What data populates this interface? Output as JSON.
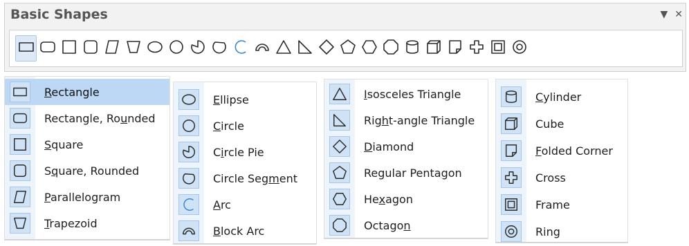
{
  "panel": {
    "title": "Basic Shapes",
    "menu_icon": "▼",
    "close_icon": "✕"
  },
  "toolbar": {
    "icons": [
      "rectangle-icon",
      "rectangle-rounded-icon",
      "square-icon",
      "square-rounded-icon",
      "parallelogram-icon",
      "trapezoid-icon",
      "ellipse-icon",
      "circle-icon",
      "circle-pie-icon",
      "circle-segment-icon",
      "arc-icon",
      "block-arc-icon",
      "isosceles-triangle-icon",
      "right-triangle-icon",
      "diamond-icon",
      "pentagon-icon",
      "hexagon-icon",
      "octagon-icon",
      "cylinder-icon",
      "cube-icon",
      "folded-corner-icon",
      "cross-icon",
      "frame-icon",
      "ring-icon"
    ],
    "active_index": 0
  },
  "columns": [
    {
      "items": [
        {
          "pre": "",
          "u": "R",
          "post": "ectangle",
          "icon": "rectangle-icon"
        },
        {
          "pre": "Rectangle, Ro",
          "u": "u",
          "post": "nded",
          "icon": "rectangle-rounded-icon"
        },
        {
          "pre": "",
          "u": "S",
          "post": "quare",
          "icon": "square-icon"
        },
        {
          "pre": "S",
          "u": "q",
          "post": "uare, Rounded",
          "icon": "square-rounded-icon"
        },
        {
          "pre": "",
          "u": "P",
          "post": "arallelogram",
          "icon": "parallelogram-icon"
        },
        {
          "pre": "",
          "u": "T",
          "post": "rapezoid",
          "icon": "trapezoid-icon"
        }
      ]
    },
    {
      "items": [
        {
          "pre": "",
          "u": "E",
          "post": "llipse",
          "icon": "ellipse-icon"
        },
        {
          "pre": "",
          "u": "C",
          "post": "ircle",
          "icon": "circle-icon"
        },
        {
          "pre": "C",
          "u": "i",
          "post": "rcle Pie",
          "icon": "circle-pie-icon"
        },
        {
          "pre": "Circle Seg",
          "u": "m",
          "post": "ent",
          "icon": "circle-segment-icon"
        },
        {
          "pre": "",
          "u": "A",
          "post": "rc",
          "icon": "arc-icon"
        },
        {
          "pre": "",
          "u": "B",
          "post": "lock Arc",
          "icon": "block-arc-icon"
        }
      ]
    },
    {
      "items": [
        {
          "pre": "",
          "u": "I",
          "post": "sosceles Triangle",
          "icon": "isosceles-triangle-icon"
        },
        {
          "pre": "Rig",
          "u": "h",
          "post": "t-angle Triangle",
          "icon": "right-triangle-icon"
        },
        {
          "pre": "",
          "u": "D",
          "post": "iamond",
          "icon": "diamond-icon"
        },
        {
          "pre": "Regular Penta",
          "u": "g",
          "post": "on",
          "icon": "pentagon-icon"
        },
        {
          "pre": "He",
          "u": "x",
          "post": "agon",
          "icon": "hexagon-icon"
        },
        {
          "pre": "Octago",
          "u": "n",
          "post": "",
          "icon": "octagon-icon"
        }
      ]
    },
    {
      "items": [
        {
          "pre": "",
          "u": "C",
          "post": "ylinder",
          "icon": "cylinder-icon"
        },
        {
          "pre": "Cube",
          "u": "",
          "post": "",
          "icon": "cube-icon"
        },
        {
          "pre": "",
          "u": "F",
          "post": "olded Corner",
          "icon": "folded-corner-icon"
        },
        {
          "pre": "Cross",
          "u": "",
          "post": "",
          "icon": "cross-icon"
        },
        {
          "pre": "Frame",
          "u": "",
          "post": "",
          "icon": "frame-icon"
        },
        {
          "pre": "Ring",
          "u": "",
          "post": "",
          "icon": "ring-icon"
        }
      ]
    }
  ],
  "colors": {
    "selected_bg": "#bcd8f5",
    "icon_tile": "#cfe2f6",
    "accent_arc": "#3a86d6"
  }
}
